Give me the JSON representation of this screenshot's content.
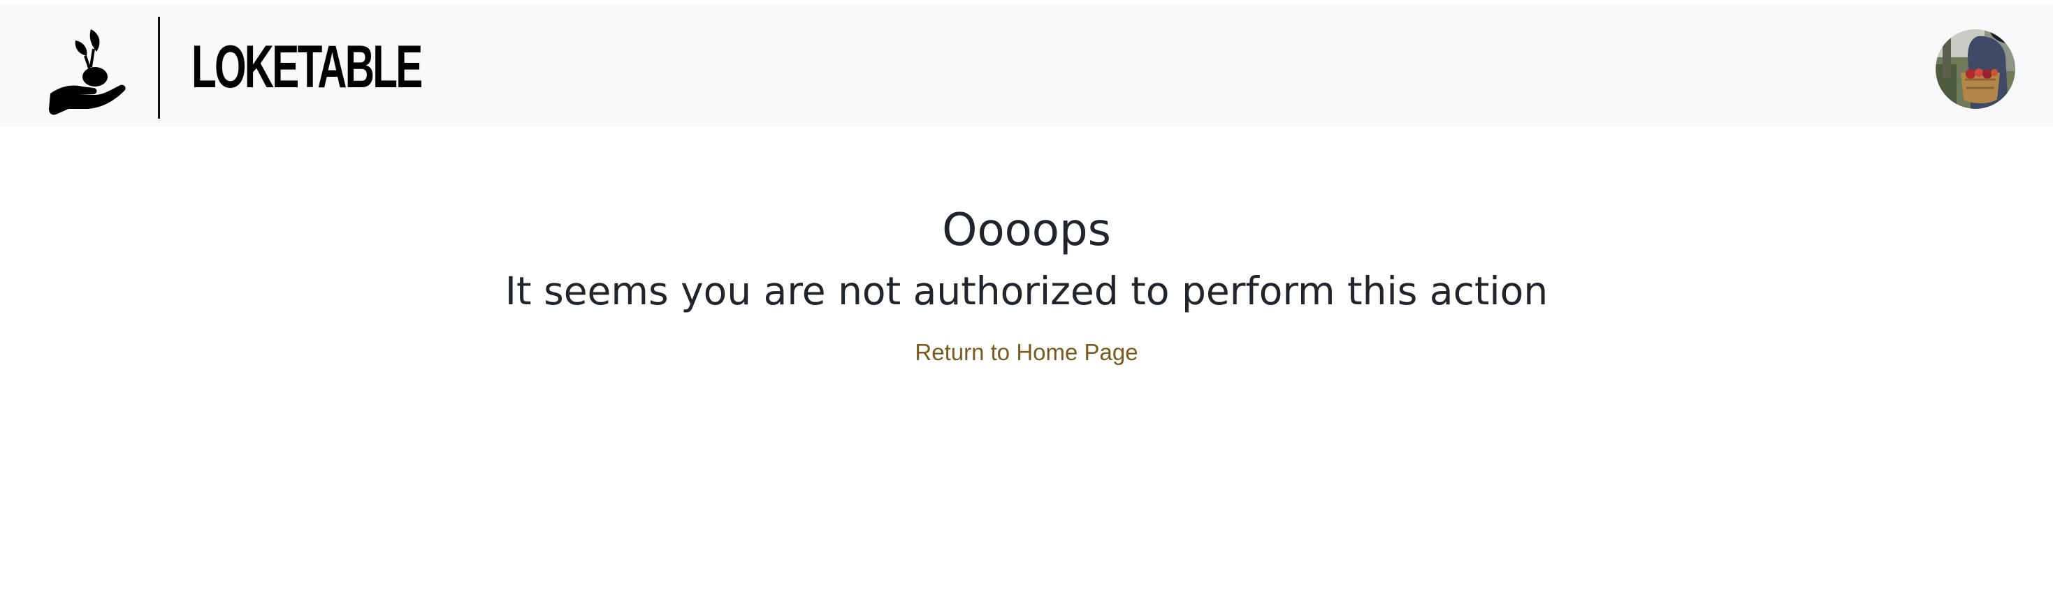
{
  "header": {
    "brand_name": "LOKETABLE",
    "logo_icon": "hand-with-sprout-icon",
    "avatar_icon": "user-avatar-photo"
  },
  "main": {
    "title": "Oooops",
    "message": "It seems you are not authorized to perform this action",
    "home_link_label": "Return to Home Page"
  },
  "colors": {
    "header_background": "#f9f9fb",
    "heading_text": "#212529",
    "link": "#7a5a1e"
  }
}
